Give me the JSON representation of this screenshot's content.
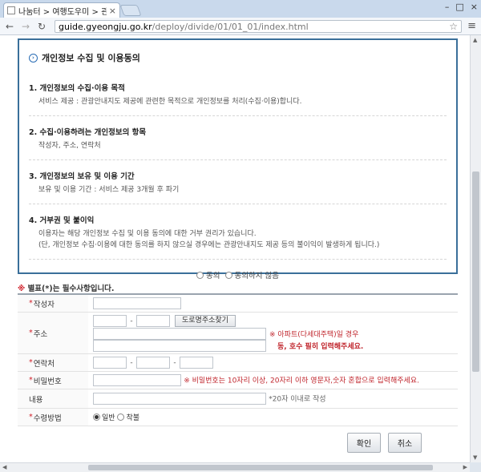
{
  "browser": {
    "tab_title": "나눔터 > 여행도우미 > 관",
    "url_host": "guide.gyeongju.go.kr",
    "url_path": "/deploy/divide/01/01_01/index.html"
  },
  "consent": {
    "title": "개인정보 수집 및 이용동의",
    "sections": [
      {
        "heading": "1. 개인정보의 수집·이용 목적",
        "lines": [
          "서비스 제공 : 관광안내지도 제공에 관련한 목적으로 개인정보를 처리(수집·이용)합니다."
        ]
      },
      {
        "heading": "2. 수집·이용하려는 개인정보의 항목",
        "lines": [
          "작성자, 주소, 연락처"
        ]
      },
      {
        "heading": "3. 개인정보의 보유 및 이용 기간",
        "lines": [
          "보유 및 이용 기간 : 서비스 제공 3개월 후 파기"
        ]
      },
      {
        "heading": "4. 거부권 및 불이익",
        "lines": [
          "이용자는 해당 개인정보 수집 및 이용 동의에 대한 거부 권리가 있습니다.",
          "(단, 개인정보 수집·이용에 대한 동의를 하지 않으실 경우에는 관광안내지도 제공 등의 불이익이 발생하게 됩니다.)"
        ]
      }
    ],
    "agree_label": "동의",
    "disagree_label": "동의하지 않음"
  },
  "form": {
    "required_note_mark": "※",
    "required_note": "별표(*)는 필수사항입니다.",
    "star": "*",
    "author_label": "작성자",
    "address_label": "주소",
    "address_search_button": "도로명주소찾기",
    "address_warn_1": "※ 아파트(다세대주택)일 경우",
    "address_warn_2": "동, 호수 필히 입력해주세요.",
    "phone_label": "연락처",
    "password_label": "비밀번호",
    "password_warn": "※ 비밀번호는 10자리 이상, 20자리 이하 영문자,숫자 혼합으로 입력해주세요.",
    "content_label": "내용",
    "content_hint": "*20자 이내로 작성",
    "receive_label": "수령방법",
    "receive_options": [
      "일반",
      "착불"
    ],
    "dash": "-"
  },
  "actions": {
    "confirm": "확인",
    "cancel": "취소"
  }
}
